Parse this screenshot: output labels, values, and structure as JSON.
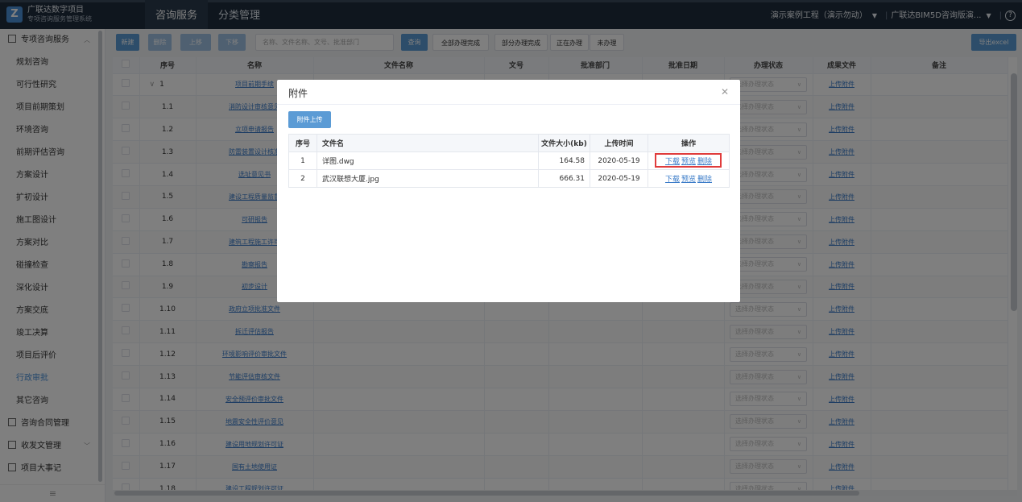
{
  "header": {
    "brand_line1": "广联达数字项目",
    "brand_line2": "专项咨询服务管理系统",
    "logo_letter": "Z",
    "nav": [
      {
        "label": "咨询服务",
        "active": true
      },
      {
        "label": "分类管理",
        "active": false
      }
    ],
    "project_selector": "演示案例工程（演示勿动）",
    "org_selector": "广联达BIM5D咨询版演...",
    "help_icon": "question-circle-icon"
  },
  "sidebar": {
    "items": [
      {
        "label": "专项咨询服务",
        "group": true,
        "icon": "folder-icon",
        "expanded": true
      },
      {
        "label": "规划咨询"
      },
      {
        "label": "可行性研究"
      },
      {
        "label": "项目前期策划"
      },
      {
        "label": "环境咨询"
      },
      {
        "label": "前期评估咨询"
      },
      {
        "label": "方案设计"
      },
      {
        "label": "扩初设计"
      },
      {
        "label": "施工图设计"
      },
      {
        "label": "方案对比"
      },
      {
        "label": "碰撞检查"
      },
      {
        "label": "深化设计"
      },
      {
        "label": "方案交底"
      },
      {
        "label": "竣工决算"
      },
      {
        "label": "项目后评价"
      },
      {
        "label": "行政审批",
        "active": true
      },
      {
        "label": "其它咨询"
      },
      {
        "label": "咨询合同管理",
        "group": true,
        "icon": "contract-icon"
      },
      {
        "label": "收发文管理",
        "group": true,
        "icon": "mail-icon",
        "expanded": false
      },
      {
        "label": "项目大事记",
        "group": true,
        "icon": "note-icon"
      }
    ],
    "collapse_icon": "menu-collapse-icon"
  },
  "toolbar": {
    "new_label": "新建",
    "delete_label": "删除",
    "up_label": "上移",
    "down_label": "下移",
    "search_placeholder": "名称、文件名称、文号、批准部门",
    "query_label": "查询",
    "filter_all_done": "全部办理完成",
    "filter_part_done": "部分办理完成",
    "filter_in_progress": "正在办理",
    "filter_not_done": "未办理",
    "export_label": "导出excel"
  },
  "table": {
    "columns": [
      "序号",
      "名称",
      "文件名称",
      "文号",
      "批准部门",
      "批准日期",
      "办理状态",
      "成果文件",
      "备注"
    ],
    "status_placeholder": "选择办理状态",
    "result_link": "上传附件",
    "rows": [
      {
        "no": "1",
        "name": "项目前期手续",
        "expand": true
      },
      {
        "no": "1.1",
        "name": "消防设计审核意见"
      },
      {
        "no": "1.2",
        "name": "立项申请报告"
      },
      {
        "no": "1.3",
        "name": "防雷装置设计核准"
      },
      {
        "no": "1.4",
        "name": "选址意见书"
      },
      {
        "no": "1.5",
        "name": "建设工程质量监督"
      },
      {
        "no": "1.6",
        "name": "可研报告"
      },
      {
        "no": "1.7",
        "name": "建筑工程施工许可"
      },
      {
        "no": "1.8",
        "name": "勘察报告"
      },
      {
        "no": "1.9",
        "name": "初步设计"
      },
      {
        "no": "1.10",
        "name": "政府立项批准文件"
      },
      {
        "no": "1.11",
        "name": "拆迁评估报告"
      },
      {
        "no": "1.12",
        "name": "环境影响评价审批文件"
      },
      {
        "no": "1.13",
        "name": "节能评估审核文件"
      },
      {
        "no": "1.14",
        "name": "安全预评价审批文件"
      },
      {
        "no": "1.15",
        "name": "地震安全性评价意见"
      },
      {
        "no": "1.16",
        "name": "建设用地规划许可证"
      },
      {
        "no": "1.17",
        "name": "国有土地使用证"
      },
      {
        "no": "1.18",
        "name": "建设工程规划许可证"
      }
    ]
  },
  "modal": {
    "title": "附件",
    "upload_label": "附件上传",
    "columns": [
      "序号",
      "文件名",
      "文件大小(kb)",
      "上传时间",
      "操作"
    ],
    "op_download": "下载",
    "op_preview": "预览",
    "op_delete": "删除",
    "files": [
      {
        "no": "1",
        "name": "详图.dwg",
        "size": "164.58",
        "date": "2020-05-19",
        "highlighted": true
      },
      {
        "no": "2",
        "name": "武汉联想大厦.jpg",
        "size": "666.31",
        "date": "2020-05-19",
        "highlighted": false
      }
    ]
  },
  "colors": {
    "header_bg": "#1f2d3d",
    "primary": "#5b9bd5",
    "link": "#3a7bc8",
    "highlight_box": "#e03c3c"
  }
}
